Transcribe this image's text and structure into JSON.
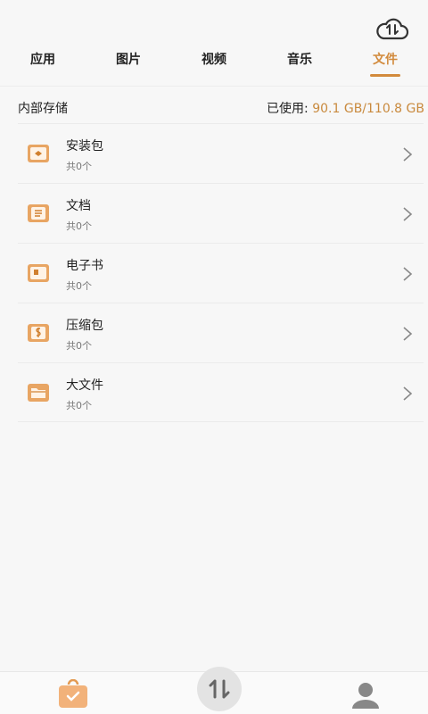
{
  "tabs": [
    {
      "label": "应用"
    },
    {
      "label": "图片"
    },
    {
      "label": "视频"
    },
    {
      "label": "音乐"
    },
    {
      "label": "文件",
      "active": true
    }
  ],
  "storage": {
    "title": "内部存储",
    "used_label": "已使用:",
    "used_value": "90.1 GB/110.8 GB"
  },
  "categories": [
    {
      "name": "安装包",
      "count": "共0个",
      "icon": "package-icon"
    },
    {
      "name": "文档",
      "count": "共0个",
      "icon": "document-icon"
    },
    {
      "name": "电子书",
      "count": "共0个",
      "icon": "ebook-icon"
    },
    {
      "name": "压缩包",
      "count": "共0个",
      "icon": "archive-icon"
    },
    {
      "name": "大文件",
      "count": "共0个",
      "icon": "folder-icon"
    }
  ],
  "colors": {
    "accent": "#d28a3c",
    "icon_fill": "#e8a563"
  }
}
